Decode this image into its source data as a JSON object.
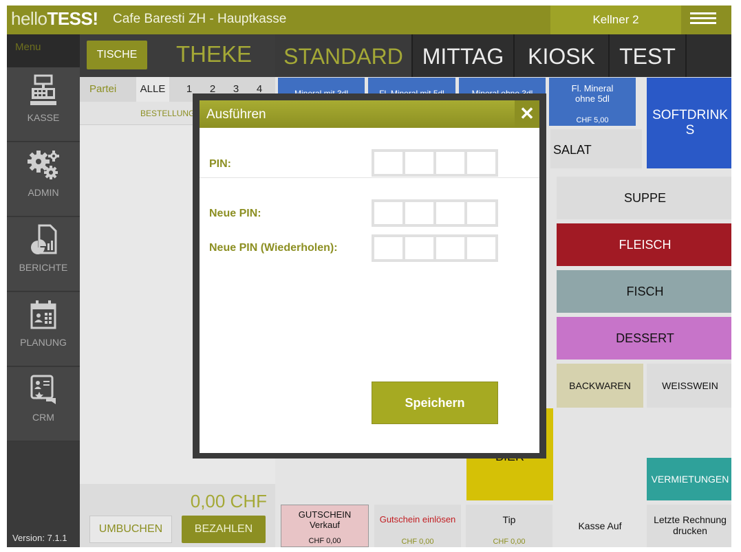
{
  "topbar": {
    "logo_hello": "hello",
    "logo_tess": "TESS",
    "logo_bang": "!",
    "store": "Cafe Baresti ZH - Hauptkasse",
    "waiter": "Kellner 2"
  },
  "sidebar": {
    "menu": "Menu",
    "items": [
      {
        "label": "KASSE",
        "icon": "cash-register-icon"
      },
      {
        "label": "ADMIN",
        "icon": "gears-icon"
      },
      {
        "label": "BERICHTE",
        "icon": "report-icon"
      },
      {
        "label": "PLANUNG",
        "icon": "calendar-icon"
      },
      {
        "label": "CRM",
        "icon": "crm-icon"
      }
    ],
    "version": "Version: 7.1.1"
  },
  "order": {
    "tische": "TISCHE",
    "theke": "THEKE",
    "partei": "Partei",
    "tabs": [
      "ALLE",
      "1",
      "2",
      "3",
      "4"
    ],
    "bestellung": "BESTELLUNG",
    "total": "0,00 CHF",
    "umbuchen": "UMBUCHEN",
    "bezahlen": "BEZAHLEN"
  },
  "categories": [
    "STANDARD",
    "MITTAG",
    "KIOSK",
    "TEST"
  ],
  "tiles": {
    "mineral3": "Mineral mit 3dl",
    "flmineral5": "Fl. Mineral mit 5dl",
    "mineralohne3": "Mineral ohne 3dl",
    "flmineralohne_1": "Fl. Mineral",
    "flmineralohne_2": "ohne 5dl",
    "flmineralohne_price": "CHF 5,00",
    "softdrinks_1": "SOFTDRINK",
    "softdrinks_2": "S",
    "salat": "SALAT",
    "suppe": "SUPPE",
    "fleisch": "FLEISCH",
    "fisch": "FISCH",
    "dessert": "DESSERT",
    "backwaren": "BACKWAREN",
    "weisswein": "WEISSWEIN",
    "bier": "BIER",
    "vermietungen": "VERMIETUNGEN",
    "gutschein_1": "GUTSCHEIN",
    "gutschein_2": "Verkauf",
    "gutschein_price": "CHF 0,00",
    "einloesen": "Gutschein einlösen",
    "einloesen_price": "CHF 0,00",
    "tip": "Tip",
    "tip_price": "CHF 0,00",
    "kasse_auf": "Kasse Auf",
    "letzte_1": "Letzte Rechnung",
    "letzte_2": "drucken"
  },
  "colors": {
    "brand_olive": "#8c8f22",
    "mineral_blue": "#3f6fc2",
    "softdrinks_blue": "#2a59c7",
    "fleisch_red": "#a11a24",
    "fisch_teal": "#8fa6a9",
    "dessert_pink": "#c774c9",
    "backwaren_beige": "#d6d2ae",
    "vermietungen_teal": "#2fa19a",
    "bier_yellow": "#d5c106",
    "gutschein_pink": "#e8c4c6"
  },
  "modal": {
    "title": "Ausführen",
    "pin": "PIN:",
    "new_pin": "Neue PIN:",
    "repeat_pin": "Neue PIN (Wiederholen):",
    "save": "Speichern"
  }
}
